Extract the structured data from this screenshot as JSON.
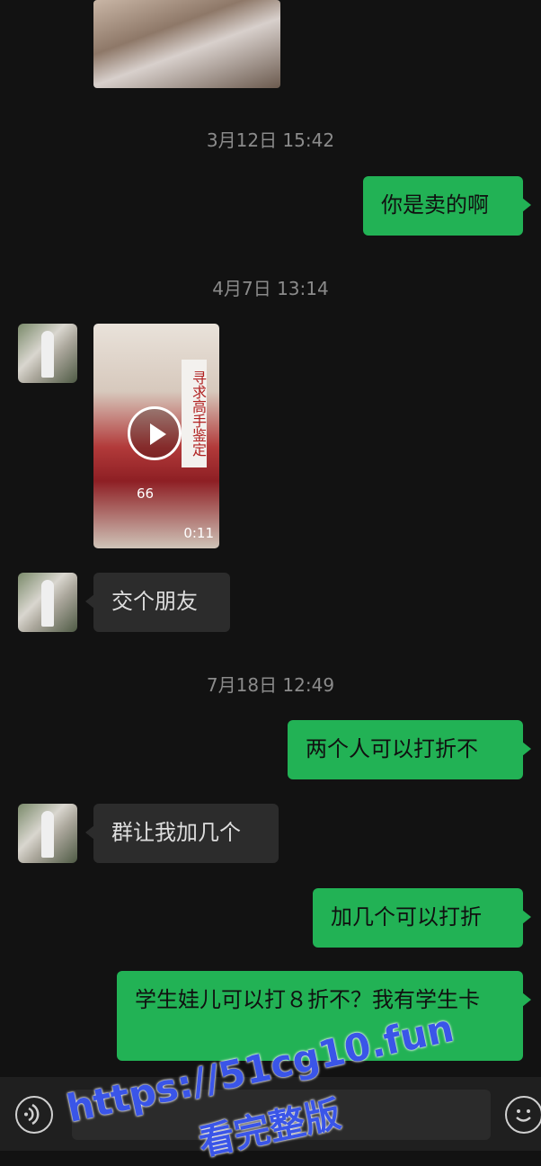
{
  "messages": {
    "ts1": "3月12日 15:42",
    "out1": "你是卖的啊",
    "ts2": "4月7日 13:14",
    "video_duration": "0:11",
    "video_sticker_text": "66",
    "video_banner_text": "寻求高手鉴定",
    "in1": "交个朋友",
    "ts3": "7月18日 12:49",
    "out2": "两个人可以打折不",
    "in2": "群让我加几个",
    "out3": "加几个可以打折",
    "out4": "学生娃儿可以打８折不？我有学生卡"
  },
  "watermark": {
    "line1": "https://51cg10.fun",
    "line2": "看完整版"
  },
  "icons": {
    "voice": "voice-icon",
    "emoji": "emoji-icon"
  },
  "colors": {
    "background": "#121212",
    "outgoing_bubble": "#22b255",
    "incoming_bubble": "#2c2c2c",
    "watermark": "#3a55e8"
  }
}
